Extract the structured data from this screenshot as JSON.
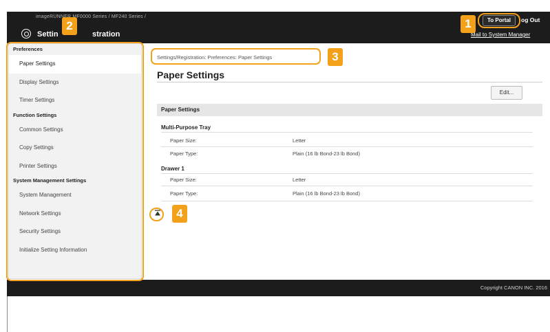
{
  "header": {
    "model_text": "imageRUNNER MF0000 Series / MF240 Series /",
    "app_title": "Settin",
    "app_title_right": "stration",
    "to_portal": "To Portal",
    "log_out": "og Out",
    "mail_link": "Mail to System Manager"
  },
  "sidebar": {
    "sections": [
      {
        "title": "Preferences",
        "items": [
          "Paper Settings",
          "Display Settings",
          "Timer Settings"
        ]
      },
      {
        "title": "Function Settings",
        "items": [
          "Common Settings",
          "Copy Settings",
          "Printer Settings"
        ]
      },
      {
        "title": "System Management Settings",
        "items": [
          "System Management",
          "Network Settings",
          "Security Settings",
          "Initialize Setting Information"
        ]
      }
    ],
    "active_item": "Paper Settings"
  },
  "main": {
    "breadcrumb": "Settings/Registration: Preferences: Paper Settings",
    "title": "Paper Settings",
    "edit_button": "Edit...",
    "section_title": "Paper Settings",
    "groups": [
      {
        "name": "Multi-Purpose Tray",
        "rows": [
          {
            "label": "Paper Size:",
            "value": "Letter"
          },
          {
            "label": "Paper Type:",
            "value": "Plain (16 lb Bond-23 lb Bond)"
          }
        ]
      },
      {
        "name": "Drawer 1",
        "rows": [
          {
            "label": "Paper Size:",
            "value": "Letter"
          },
          {
            "label": "Paper Type:",
            "value": "Plain (16 lb Bond-23 lb Bond)"
          }
        ]
      }
    ],
    "to_top_icon": "to-top-arrow-icon"
  },
  "footer": {
    "copyright": "Copyright CANON INC. 2016"
  },
  "annotations": {
    "badges": [
      "1",
      "2",
      "3",
      "4"
    ],
    "color": "#f3a01b"
  }
}
